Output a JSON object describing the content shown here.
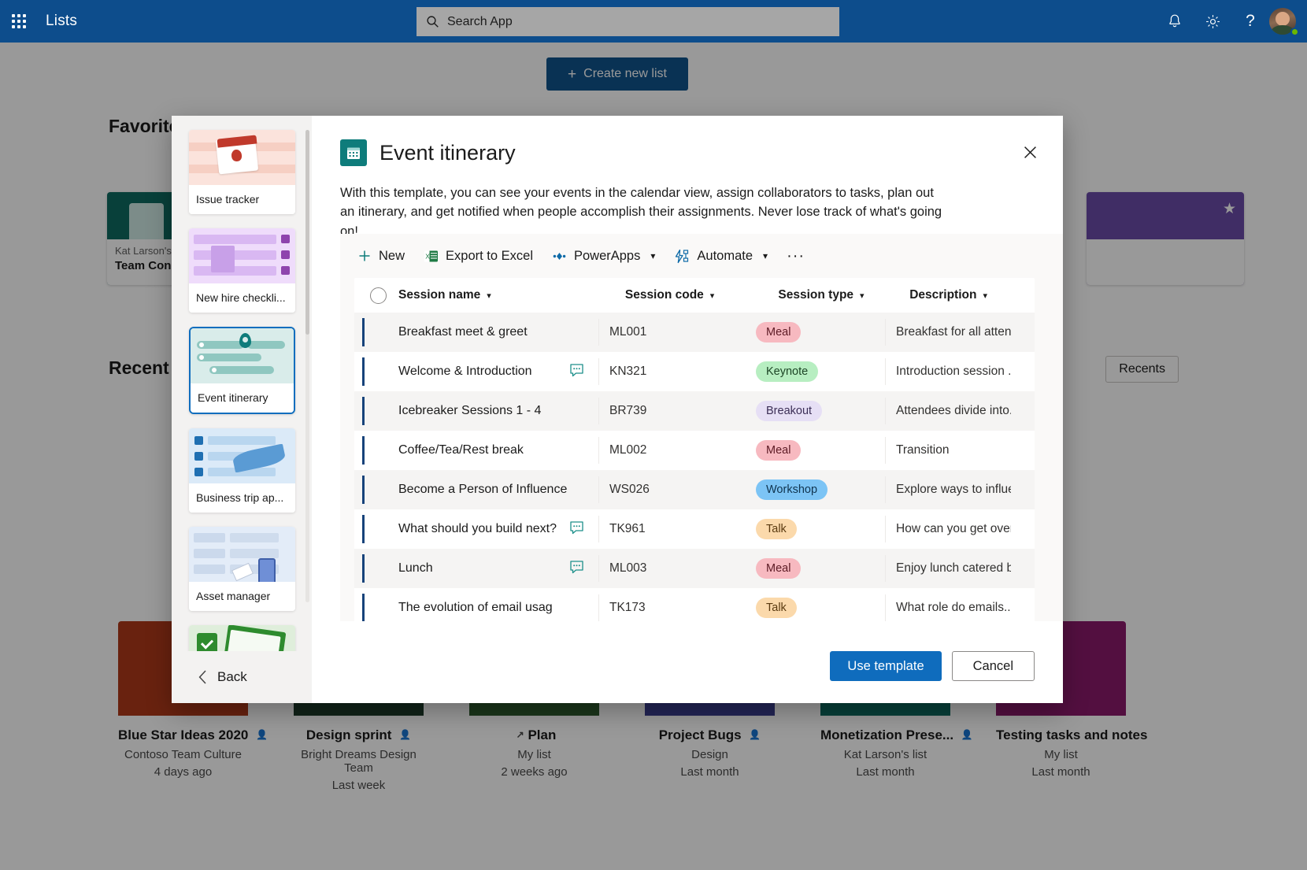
{
  "suitebar": {
    "waffle_label": "App launcher",
    "app_name": "Lists",
    "search_placeholder": "Search App",
    "notifications_label": "Notifications",
    "settings_label": "Settings",
    "help_label": "?",
    "account_label": "Account manager"
  },
  "page": {
    "create_new_list": "Create new list",
    "favorites_title": "Favorites",
    "recent_title": "Recent",
    "recents_filter": "Recents",
    "favorites": [
      {
        "owner": "Kat Larson's",
        "name": "Team Con...",
        "color": "#0e6b62",
        "starred": true
      },
      {
        "owner": "",
        "name": "",
        "color": "#6b4ba8",
        "starred": true
      }
    ],
    "recents": [
      {
        "name": "Blue Star Ideas 2020",
        "shared": true,
        "sub": "Contoso Team Culture",
        "time": "4 days ago",
        "color": "#b03a1a"
      },
      {
        "name": "Design sprint",
        "shared": true,
        "sub": "Bright Dreams Design Team",
        "time": "Last week",
        "color": "#1d3b2a"
      },
      {
        "name": "Plan",
        "shared": false,
        "sub": "My list",
        "time": "2 weeks ago",
        "color": "#2d5a2d"
      },
      {
        "name": "Project Bugs",
        "shared": true,
        "sub": "Design",
        "time": "Last month",
        "color": "#b03a1a"
      },
      {
        "name": "Monetization Prese...",
        "shared": true,
        "sub": "Kat Larson's list",
        "time": "Last month",
        "color": "#0e6b62"
      },
      {
        "name": "Testing tasks and notes",
        "shared": false,
        "sub": "My list",
        "time": "Last month",
        "color": "#8a1a6b"
      }
    ]
  },
  "modal": {
    "close_label": "Close",
    "back_label": "Back",
    "templates": [
      {
        "label": "Issue tracker",
        "art": "issue-tracker",
        "selected": false
      },
      {
        "label": "New hire checkli...",
        "art": "new-hire",
        "selected": false
      },
      {
        "label": "Event itinerary",
        "art": "event-itinerary",
        "selected": true
      },
      {
        "label": "Business trip ap...",
        "art": "business-trip",
        "selected": false
      },
      {
        "label": "Asset manager",
        "art": "asset-manager",
        "selected": false
      },
      {
        "label": "",
        "art": "recruitment",
        "selected": false
      }
    ],
    "title": "Event itinerary",
    "icon": "calendar-icon",
    "description": "With this template, you can see your events in the calendar view, assign collaborators to tasks, plan out an itinerary, and get notified when people accomplish their assignments. Never lose track of what's going on!",
    "commands": [
      {
        "label": "New",
        "icon": "plus-icon",
        "has_chevron": false
      },
      {
        "label": "Export to Excel",
        "icon": "excel-icon",
        "has_chevron": false
      },
      {
        "label": "PowerApps",
        "icon": "powerapps-icon",
        "has_chevron": true
      },
      {
        "label": "Automate",
        "icon": "automate-icon",
        "has_chevron": true
      },
      {
        "label": "···",
        "icon": "more-icon",
        "has_chevron": false
      }
    ],
    "table": {
      "columns": [
        "Session name",
        "Session code",
        "Session type",
        "Description"
      ],
      "rows": [
        {
          "name": "Breakfast meet & greet",
          "note": false,
          "code": "ML001",
          "type": "Meal",
          "type_bg": "#f7b9c0",
          "type_fg": "#5c1a24",
          "desc": "Breakfast for all atten..."
        },
        {
          "name": "Welcome & Introduction",
          "note": true,
          "code": "KN321",
          "type": "Keynote",
          "type_bg": "#b7eec1",
          "type_fg": "#1d4526",
          "desc": "Introduction session ..."
        },
        {
          "name": "Icebreaker Sessions 1 - 4",
          "note": false,
          "code": "BR739",
          "type": "Breakout",
          "type_bg": "#e6dff5",
          "type_fg": "#3b2e56",
          "desc": "Attendees divide into..."
        },
        {
          "name": "Coffee/Tea/Rest break",
          "note": false,
          "code": "ML002",
          "type": "Meal",
          "type_bg": "#f7b9c0",
          "type_fg": "#5c1a24",
          "desc": "Transition"
        },
        {
          "name": "Become a Person of Influence",
          "note": false,
          "code": "WS026",
          "type": "Workshop",
          "type_bg": "#7cc4f5",
          "type_fg": "#10344f",
          "desc": "Explore ways to influe..."
        },
        {
          "name": "What should you build next?",
          "note": true,
          "code": "TK961",
          "type": "Talk",
          "type_bg": "#fbd9ab",
          "type_fg": "#5a3a10",
          "desc": "How can you get over..."
        },
        {
          "name": "Lunch",
          "note": true,
          "code": "ML003",
          "type": "Meal",
          "type_bg": "#f7b9c0",
          "type_fg": "#5c1a24",
          "desc": "Enjoy lunch catered b..."
        },
        {
          "name": "The evolution of email usag",
          "note": false,
          "code": "TK173",
          "type": "Talk",
          "type_bg": "#fbd9ab",
          "type_fg": "#5a3a10",
          "desc": "What role do emails..."
        }
      ]
    },
    "use_template": "Use template",
    "cancel": "Cancel"
  },
  "colors": {
    "suitebar": "#0d4d8c",
    "primary_button": "#0f6cbd",
    "selected_border": "#106ebe",
    "row_accent": "#16427a"
  }
}
